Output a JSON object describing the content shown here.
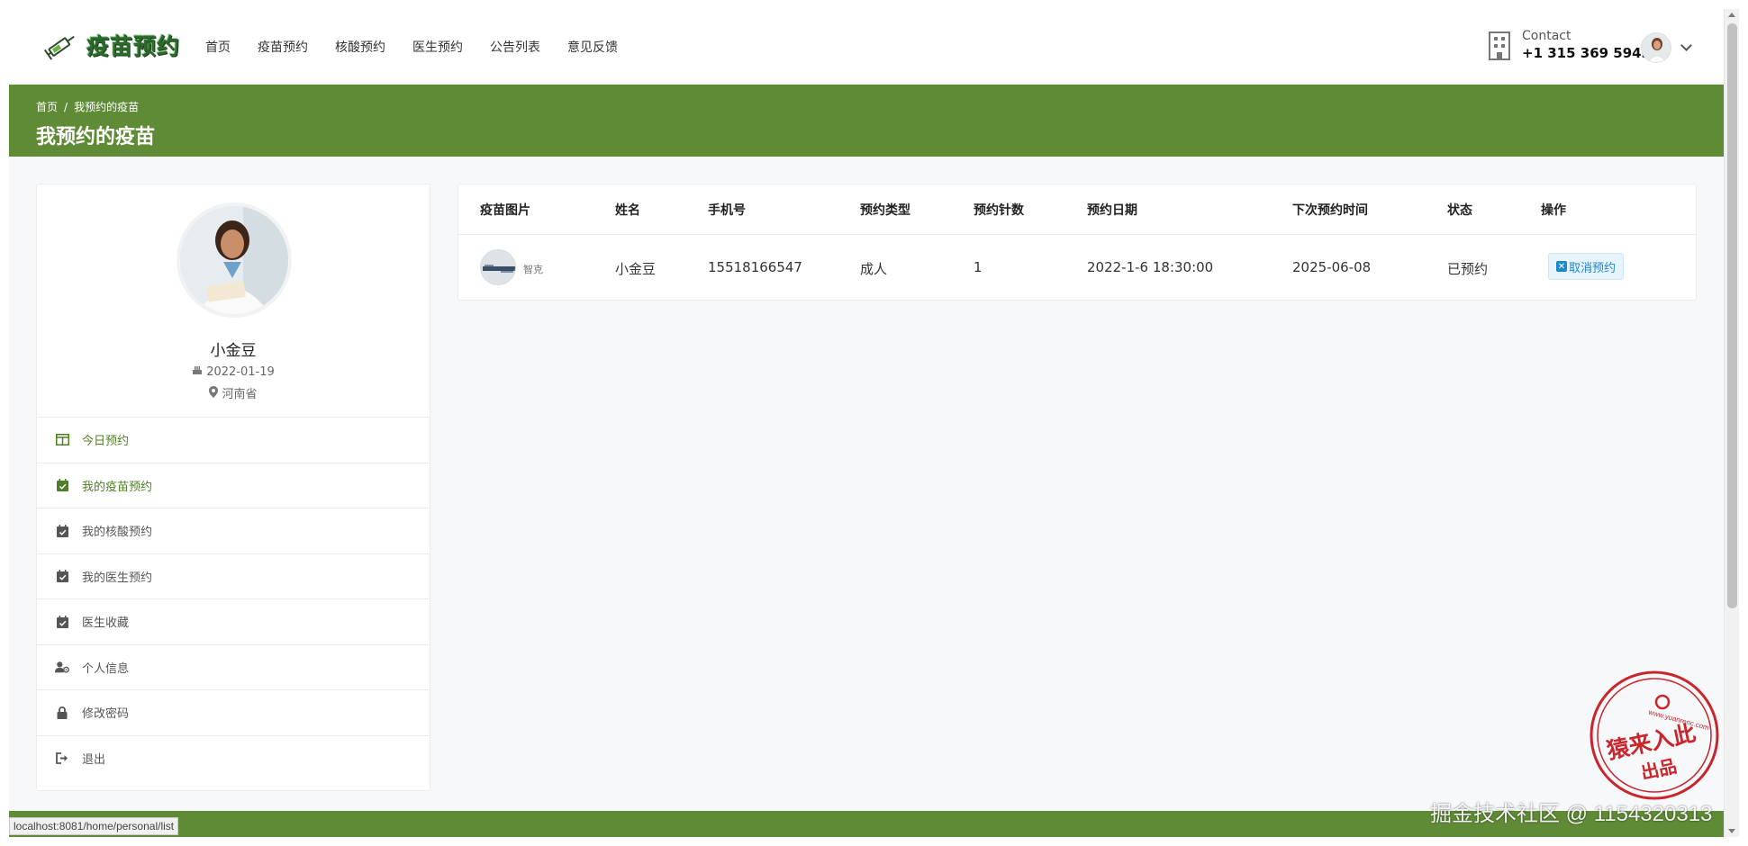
{
  "header": {
    "brand": "疫苗预约",
    "nav": [
      "首页",
      "疫苗预约",
      "核酸预约",
      "医生预约",
      "公告列表",
      "意见反馈"
    ],
    "contact_label": "Contact",
    "contact_phone": "+1 315 369 5943"
  },
  "banner": {
    "breadcrumb_home": "首页",
    "breadcrumb_sep": "/",
    "breadcrumb_current": "我预约的疫苗",
    "title": "我预约的疫苗"
  },
  "profile": {
    "name": "小金豆",
    "birthday": "2022-01-19",
    "location": "河南省"
  },
  "menu": [
    {
      "label": "今日预约",
      "icon": "layout-icon"
    },
    {
      "label": "我的疫苗预约",
      "icon": "calendar-check-icon"
    },
    {
      "label": "我的核酸预约",
      "icon": "calendar-check-icon"
    },
    {
      "label": "我的医生预约",
      "icon": "calendar-check-icon"
    },
    {
      "label": "医生收藏",
      "icon": "calendar-check-icon"
    },
    {
      "label": "个人信息",
      "icon": "user-gear-icon"
    },
    {
      "label": "修改密码",
      "icon": "lock-icon"
    },
    {
      "label": "退出",
      "icon": "sign-out-icon"
    }
  ],
  "table": {
    "headers": [
      "疫苗图片",
      "姓名",
      "手机号",
      "预约类型",
      "预约针数",
      "预约日期",
      "下次预约时间",
      "状态",
      "操作"
    ],
    "rows": [
      {
        "image_caption": "智克",
        "name": "小金豆",
        "phone": "15518166547",
        "type": "成人",
        "dose": "1",
        "date": "2022-1-6 18:30:00",
        "next": "2025-06-08",
        "status": "已预约",
        "action": "取消预约"
      }
    ]
  },
  "status_bar": {
    "url": "localhost:8081/home/personal/list"
  },
  "stamp": {
    "text_top": "猿来入此",
    "text_bottom": "出品",
    "url": "www.yuanrenc.com"
  },
  "watermark": "掘金技术社区 @ 1154320313",
  "colors": {
    "primary": "#5f8b36",
    "accent_blue": "#1e88c9",
    "stamp_red": "#c8252c"
  }
}
